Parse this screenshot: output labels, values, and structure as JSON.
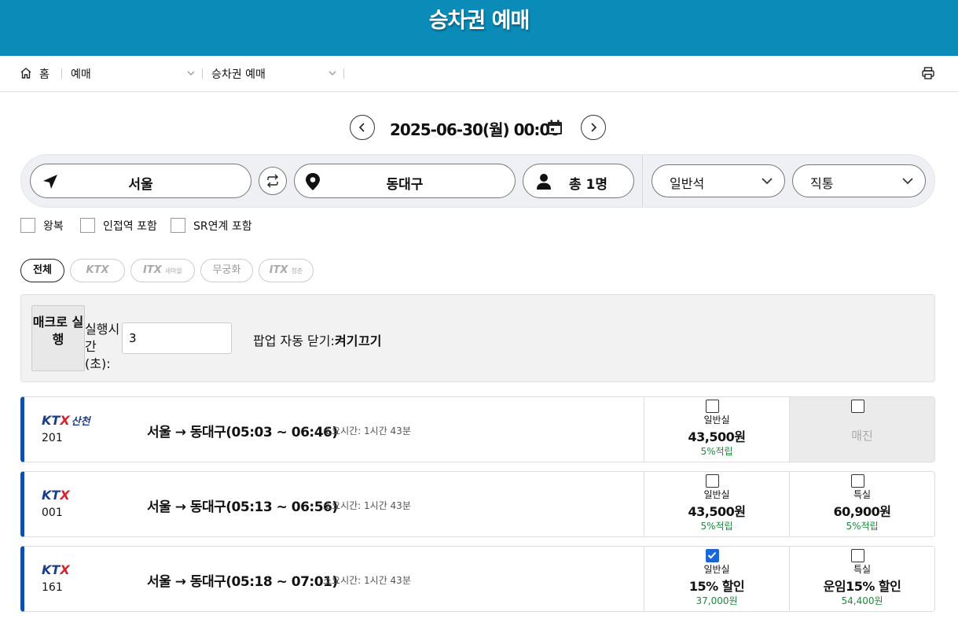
{
  "header": {
    "title": "승차권 예매"
  },
  "breadcrumb": {
    "home": "홈",
    "level1": "예매",
    "level2": "승차권 예매"
  },
  "date": {
    "value": "2025-06-30(월) 00:00"
  },
  "search": {
    "origin": "서울",
    "destination": "동대구",
    "passengers": "총 1명",
    "seat_class": "일반석",
    "route_type": "직통"
  },
  "options": {
    "roundtrip": "왕복",
    "nearby": "인접역 포함",
    "sr": "SR연계 포함"
  },
  "filters": {
    "all": "전체",
    "ktx": "KTX",
    "itx_saemaeul": "ITX",
    "itx_saemaeul_sub": "새마을",
    "mugunghwa": "무궁화",
    "itx_cheongchun": "ITX",
    "itx_cheongchun_sub": "청춘"
  },
  "macro": {
    "button": "매크로 실행",
    "interval_label": "실행시간(초):",
    "interval_value": "3",
    "popup_label": "팝업 자동 닫기:",
    "popup_on": "켜기",
    "popup_off": "끄기"
  },
  "trains": [
    {
      "logo": "KTX",
      "logo_sub": "산천",
      "number": "201",
      "route": "서울 → 동대구(05:03 ~ 06:46)",
      "duration": "소요시간: 1시간 43분",
      "seat1": {
        "class": "일반실",
        "price": "43,500원",
        "points": "5%적립",
        "checked": false
      },
      "seat2": {
        "soldout": true,
        "label": "매진"
      }
    },
    {
      "logo": "KTX",
      "logo_sub": "",
      "number": "001",
      "route": "서울 → 동대구(05:13 ~ 06:56)",
      "duration": "소요시간: 1시간 43분",
      "seat1": {
        "class": "일반실",
        "price": "43,500원",
        "points": "5%적립",
        "checked": false
      },
      "seat2": {
        "class": "특실",
        "price": "60,900원",
        "points": "5%적립",
        "checked": false
      }
    },
    {
      "logo": "KTX",
      "logo_sub": "",
      "number": "161",
      "route": "서울 → 동대구(05:18 ~ 07:01)",
      "duration": "소요시간: 1시간 43분",
      "seat1": {
        "class": "일반실",
        "price": "15% 할인",
        "points": "37,000원",
        "checked": true
      },
      "seat2": {
        "class": "특실",
        "price": "운임15% 할인",
        "points": "54,400원",
        "checked": false
      }
    }
  ],
  "colors": {
    "header_bg": "#0a8bb8",
    "train_accent": "#0f4fa8",
    "points_green": "#1a8c3a",
    "checkbox_checked": "#1a66d6"
  }
}
